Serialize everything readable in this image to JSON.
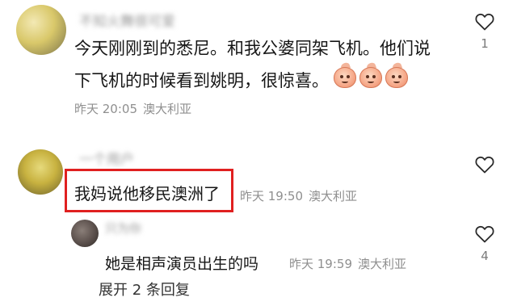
{
  "comments": [
    {
      "author": "不知火舞很可爱",
      "text_line1": "今天刚刚到的悉尼。和我公婆同架飞机。他们说",
      "text_line2": "下飞机的时候看到姚明，很惊喜。",
      "emojis": [
        "peach-emoji",
        "peach-emoji",
        "peach-emoji"
      ],
      "time": "昨天 20:05",
      "location": "澳大利亚",
      "likes": "1"
    },
    {
      "author": "一个用户",
      "text": "我妈说他移民澳洲了",
      "time": "昨天 19:50",
      "location": "澳大利亚",
      "likes": ""
    }
  ],
  "reply": {
    "author": "只为你",
    "text": "她是相声演员出生的吗",
    "time": "昨天 19:59",
    "location": "澳大利亚",
    "likes": "4"
  },
  "expand_replies": "展开 2 条回复",
  "icons": {
    "like": "heart-outline-icon",
    "emoji": "peach-face-emoji"
  },
  "colors": {
    "highlight": "#e02020",
    "meta_text": "#8f8f8f"
  }
}
